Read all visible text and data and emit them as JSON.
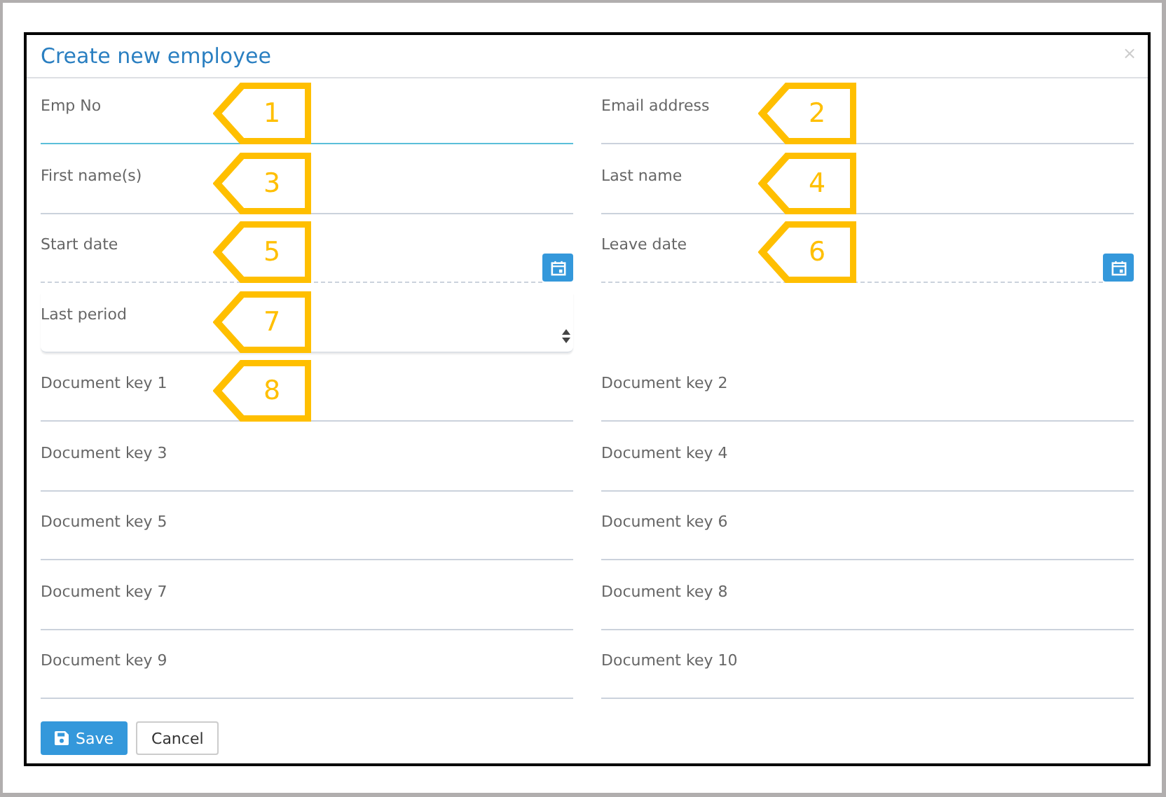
{
  "dialog": {
    "title": "Create new employee",
    "close": "×"
  },
  "rows": [
    {
      "fields": [
        {
          "label": "Emp No",
          "kind": "text",
          "focused": true,
          "callout": "1"
        },
        {
          "label": "Email address",
          "kind": "text",
          "focused": false,
          "callout": "2"
        }
      ]
    },
    {
      "fields": [
        {
          "label": "First name(s)",
          "kind": "text",
          "focused": false,
          "callout": "3"
        },
        {
          "label": "Last name",
          "kind": "text",
          "focused": false,
          "callout": "4"
        }
      ]
    },
    {
      "fields": [
        {
          "label": "Start date",
          "kind": "date",
          "focused": false,
          "callout": "5"
        },
        {
          "label": "Leave date",
          "kind": "date",
          "focused": false,
          "callout": "6"
        }
      ]
    },
    {
      "fields": [
        {
          "label": "Last period",
          "kind": "select",
          "focused": false,
          "callout": "7"
        }
      ]
    },
    {
      "fields": [
        {
          "label": "Document key 1",
          "kind": "text",
          "focused": false,
          "callout": "8"
        },
        {
          "label": "Document key 2",
          "kind": "text",
          "focused": false
        }
      ]
    },
    {
      "fields": [
        {
          "label": "Document key 3",
          "kind": "text",
          "focused": false
        },
        {
          "label": "Document key 4",
          "kind": "text",
          "focused": false
        }
      ]
    },
    {
      "fields": [
        {
          "label": "Document key 5",
          "kind": "text",
          "focused": false
        },
        {
          "label": "Document key 6",
          "kind": "text",
          "focused": false
        }
      ]
    },
    {
      "fields": [
        {
          "label": "Document key 7",
          "kind": "text",
          "focused": false
        },
        {
          "label": "Document key 8",
          "kind": "text",
          "focused": false
        }
      ]
    },
    {
      "fields": [
        {
          "label": "Document key 9",
          "kind": "text",
          "focused": false
        },
        {
          "label": "Document key 10",
          "kind": "text",
          "focused": false
        }
      ]
    }
  ],
  "buttons": [
    {
      "label": "Save",
      "kind": "primary"
    },
    {
      "label": "Cancel",
      "kind": "default"
    }
  ]
}
